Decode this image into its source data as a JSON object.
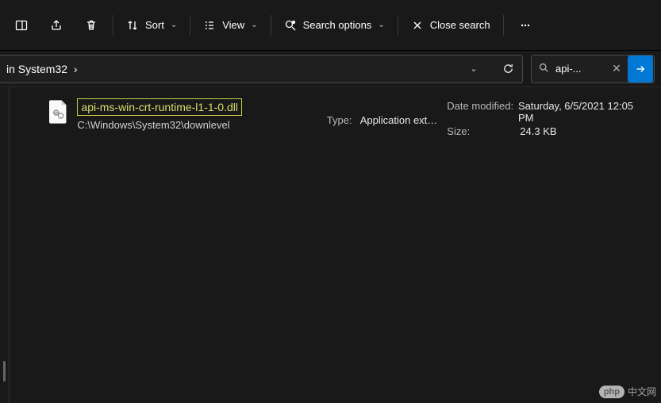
{
  "toolbar": {
    "sort_label": "Sort",
    "view_label": "View",
    "search_options_label": "Search options",
    "close_search_label": "Close search"
  },
  "address": {
    "crumb_text": "in System32",
    "search_value": "api-..."
  },
  "result": {
    "filename": "api-ms-win-crt-runtime-l1-1-0.dll",
    "path": "C:\\Windows\\System32\\downlevel",
    "type_label": "Type:",
    "type_value": "Application ext…",
    "date_label": "Date modified:",
    "date_value": "Saturday, 6/5/2021 12:05 PM",
    "size_label": "Size:",
    "size_value": "24.3 KB"
  },
  "watermark": {
    "badge": "php",
    "text": "中文网"
  }
}
